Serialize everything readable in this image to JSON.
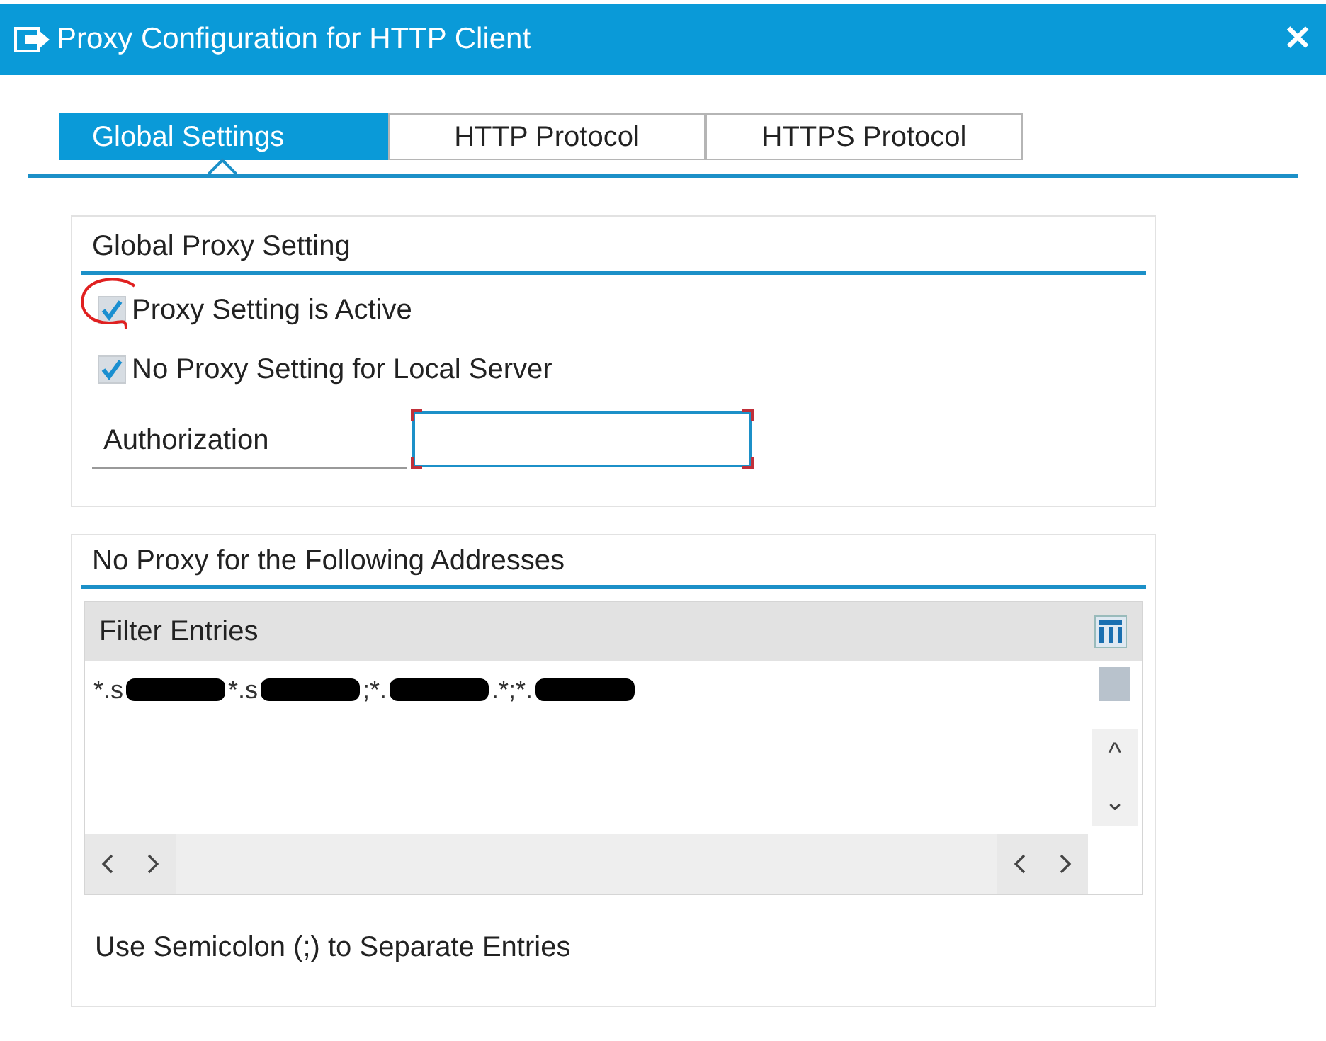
{
  "window": {
    "title": "Proxy Configuration for HTTP Client",
    "close": "✕"
  },
  "tabs": [
    {
      "label": "Global Settings",
      "selected": true
    },
    {
      "label": "HTTP Protocol",
      "selected": false
    },
    {
      "label": "HTTPS Protocol",
      "selected": false
    }
  ],
  "global_proxy_setting": {
    "title": "Global Proxy Setting",
    "checkboxes": [
      {
        "label": "Proxy Setting is Active",
        "checked": true,
        "circled": true
      },
      {
        "label": "No Proxy Setting for Local Server",
        "checked": true,
        "circled": false
      }
    ],
    "authorization": {
      "label": "Authorization"
    }
  },
  "no_proxy": {
    "title": "No Proxy for the Following Addresses",
    "filter_header": "Filter Entries",
    "entry_segments": [
      {
        "kind": "text",
        "text": "*.s"
      },
      {
        "kind": "redacted"
      },
      {
        "kind": "text",
        "text": "*.s"
      },
      {
        "kind": "redacted"
      },
      {
        "kind": "text",
        "text": ";*."
      },
      {
        "kind": "redacted"
      },
      {
        "kind": "text",
        "text": ".*;*."
      },
      {
        "kind": "redacted"
      }
    ],
    "scroll_buttons": {
      "up": "^",
      "down": "⌄"
    },
    "hint": "Use Semicolon (;) to Separate Entries"
  }
}
